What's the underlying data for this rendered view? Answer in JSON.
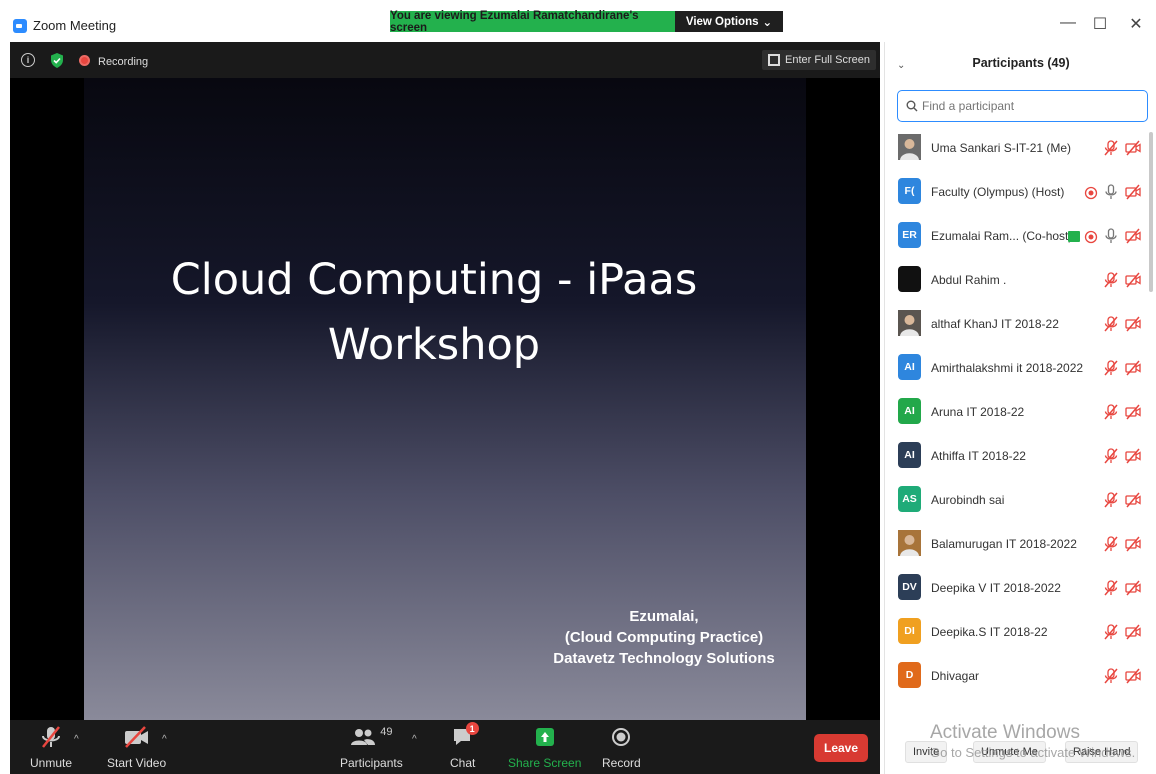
{
  "window": {
    "title": "Zoom Meeting",
    "share_banner": "You are viewing Ezumalai Ramatchandirane's screen",
    "view_options": "View Options",
    "minimize": "—",
    "maximize": "☐",
    "close": "✕"
  },
  "stage": {
    "recording_label": "Recording",
    "fullscreen_label": "Enter Full Screen"
  },
  "slide": {
    "title_line1": "Cloud Computing - iPaas",
    "title_line2": "Workshop",
    "credit_line1": "Ezumalai,",
    "credit_line2": "(Cloud Computing Practice)",
    "credit_line3": "Datavetz Technology Solutions"
  },
  "toolbar": {
    "unmute": "Unmute",
    "start_video": "Start Video",
    "participants": "Participants",
    "participants_count": "49",
    "chat": "Chat",
    "chat_badge": "1",
    "share_screen": "Share Screen",
    "record": "Record",
    "leave": "Leave"
  },
  "panel": {
    "title": "Participants (49)",
    "search_placeholder": "Find a participant",
    "participants": [
      {
        "name": "Uma Sankari S-IT-21 (Me)",
        "initials": "",
        "color": "#6b6b6b",
        "photo": true,
        "mic": "muted",
        "recording": false,
        "sharing": false
      },
      {
        "name": "Faculty (Olympus) (Host)",
        "initials": "F(",
        "color": "#2e86de",
        "photo": false,
        "mic": "on",
        "recording": true,
        "sharing": false
      },
      {
        "name": "Ezumalai Ram... (Co-host)",
        "initials": "ER",
        "color": "#2e86de",
        "photo": false,
        "mic": "on",
        "recording": true,
        "sharing": true
      },
      {
        "name": "Abdul Rahim .",
        "initials": "",
        "color": "#111111",
        "photo": false,
        "mic": "muted",
        "recording": false,
        "sharing": false
      },
      {
        "name": "althaf KhanJ IT 2018-22",
        "initials": "",
        "color": "#5a5550",
        "photo": true,
        "mic": "muted",
        "recording": false,
        "sharing": false
      },
      {
        "name": "Amirthalakshmi it 2018-2022",
        "initials": "AI",
        "color": "#2e86de",
        "photo": false,
        "mic": "muted",
        "recording": false,
        "sharing": false
      },
      {
        "name": "Aruna IT 2018-22",
        "initials": "AI",
        "color": "#22a84a",
        "photo": false,
        "mic": "muted",
        "recording": false,
        "sharing": false
      },
      {
        "name": "Athiffa IT 2018-22",
        "initials": "AI",
        "color": "#2c3e57",
        "photo": false,
        "mic": "muted",
        "recording": false,
        "sharing": false
      },
      {
        "name": "Aurobindh sai",
        "initials": "AS",
        "color": "#1fab78",
        "photo": false,
        "mic": "muted",
        "recording": false,
        "sharing": false
      },
      {
        "name": "Balamurugan IT 2018-2022",
        "initials": "",
        "color": "#a8743a",
        "photo": true,
        "mic": "muted",
        "recording": false,
        "sharing": false
      },
      {
        "name": "Deepika V IT 2018-2022",
        "initials": "DV",
        "color": "#2c3e57",
        "photo": false,
        "mic": "muted",
        "recording": false,
        "sharing": false
      },
      {
        "name": "Deepika.S IT 2018-22",
        "initials": "DI",
        "color": "#f0a020",
        "photo": false,
        "mic": "muted",
        "recording": false,
        "sharing": false
      },
      {
        "name": "Dhivagar",
        "initials": "D",
        "color": "#e06a1b",
        "photo": false,
        "mic": "muted",
        "recording": false,
        "sharing": false
      }
    ],
    "invite": "Invite",
    "unmute_me": "Unmute Me",
    "raise_hand": "Raise Hand"
  },
  "watermark": {
    "line1": "Activate Windows",
    "line2": "Go to Settings to activate Windows."
  },
  "colors": {
    "zoom_blue": "#2d8cff",
    "banner_green": "#23b14d",
    "muted_red": "#e8463f",
    "leave_red": "#d83a32"
  }
}
